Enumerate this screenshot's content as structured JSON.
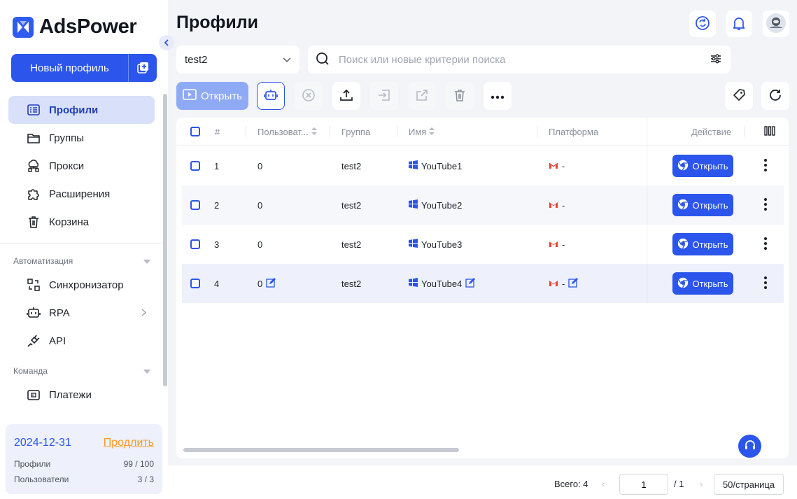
{
  "app": {
    "name": "AdsPower"
  },
  "sidebar": {
    "new_profile_label": "Новый профиль",
    "items": [
      {
        "label": "Профили",
        "icon": "profiles-icon",
        "active": true
      },
      {
        "label": "Группы",
        "icon": "folder-icon"
      },
      {
        "label": "Прокси",
        "icon": "proxy-icon"
      },
      {
        "label": "Расширения",
        "icon": "puzzle-icon"
      },
      {
        "label": "Корзина",
        "icon": "trash-icon"
      }
    ],
    "automation": {
      "title": "Автоматизация",
      "items": [
        {
          "label": "Синхронизатор",
          "icon": "sync-icon"
        },
        {
          "label": "RPA",
          "icon": "robot-icon"
        },
        {
          "label": "API",
          "icon": "api-plug-icon"
        }
      ]
    },
    "team": {
      "title": "Команда",
      "items": [
        {
          "label": "Платежи",
          "icon": "wallet-icon"
        }
      ]
    },
    "plan": {
      "date": "2024-12-31",
      "extend_label": "Продлить",
      "profiles_label": "Профили",
      "profiles_value": "99 / 100",
      "users_label": "Пользователи",
      "users_value": "3 / 3"
    }
  },
  "header": {
    "title": "Профили"
  },
  "filters": {
    "group_value": "test2",
    "search_placeholder": "Поиск или новые критерии поиска"
  },
  "toolbar": {
    "open_label": "Открыть"
  },
  "table": {
    "columns": {
      "num": "#",
      "user": "Пользоват...",
      "group": "Группа",
      "name": "Имя",
      "platform": "Платформа",
      "action": "Действие"
    },
    "rows": [
      {
        "num": "1",
        "user": "0",
        "group": "test2",
        "name": "YouTube1",
        "platform": "-",
        "action": "Открыть"
      },
      {
        "num": "2",
        "user": "0",
        "group": "test2",
        "name": "YouTube2",
        "platform": "-",
        "action": "Открыть"
      },
      {
        "num": "3",
        "user": "0",
        "group": "test2",
        "name": "YouTube3",
        "platform": "-",
        "action": "Открыть"
      },
      {
        "num": "4",
        "user": "0",
        "group": "test2",
        "name": "YouTube4",
        "platform": "-",
        "action": "Открыть"
      }
    ]
  },
  "pagination": {
    "total": "Всего: 4",
    "current_page": "1",
    "of_pages": "/ 1",
    "page_size": "50/страница"
  },
  "colors": {
    "primary": "#2b55eb",
    "extend": "#f59a23",
    "active_bg": "#d9e0fa"
  }
}
